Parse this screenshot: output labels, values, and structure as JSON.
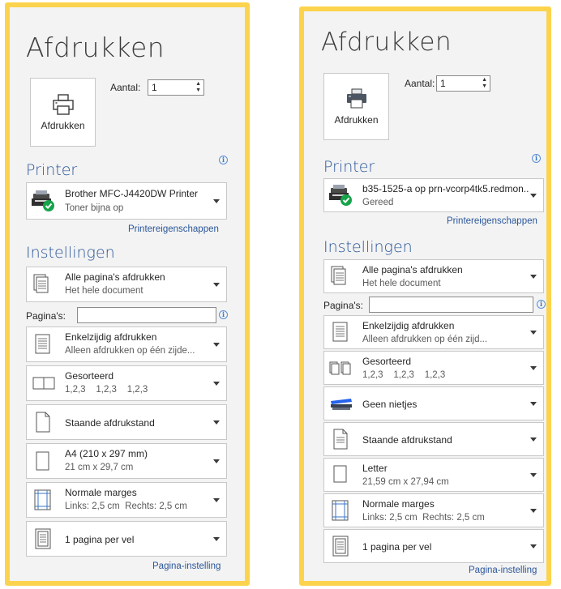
{
  "left": {
    "title": "Afdrukken",
    "print_button": "Afdrukken",
    "copies_label": "Aantal:",
    "copies_value": "1",
    "printer_heading": "Printer",
    "printer": {
      "name": "Brother MFC-J4420DW Printer",
      "status": "Toner bijna op"
    },
    "printer_properties_link": "Printereigenschappen",
    "settings_heading": "Instellingen",
    "pages_label": "Pagina's:",
    "pages_value": "",
    "settings": [
      {
        "icon": "all-pages-icon",
        "line1": "Alle pagina's afdrukken",
        "line2": "Het hele document"
      },
      {
        "icon": "one-sided-icon",
        "line1": "Enkelzijdig afdrukken",
        "line2": "Alleen afdrukken op één zijde..."
      },
      {
        "icon": "collated-icon",
        "line1": "Gesorteerd",
        "line2": "1,2,3    1,2,3    1,2,3"
      },
      {
        "icon": "portrait-icon",
        "line1": "Staande afdrukstand",
        "line2": ""
      },
      {
        "icon": "paper-size-icon",
        "line1": "A4 (210 x 297 mm)",
        "line2": "21 cm x 29,7 cm"
      },
      {
        "icon": "margins-icon",
        "line1": "Normale marges",
        "line2": "Links: 2,5 cm  Rechts: 2,5 cm"
      },
      {
        "icon": "pages-per-sheet-icon",
        "line1": "1 pagina per vel",
        "line2": ""
      }
    ],
    "page_setup_link": "Pagina-instelling"
  },
  "right": {
    "title": "Afdrukken",
    "print_button": "Afdrukken",
    "copies_label": "Aantal:",
    "copies_value": "1",
    "printer_heading": "Printer",
    "printer": {
      "name": "b35-1525-a op prn-vcorp4tk5.redmon...",
      "status": "Gereed"
    },
    "printer_properties_link": "Printereigenschappen",
    "settings_heading": "Instellingen",
    "pages_label": "Pagina's:",
    "pages_value": "",
    "settings": [
      {
        "icon": "all-pages-icon",
        "line1": "Alle pagina's afdrukken",
        "line2": "Het hele document"
      },
      {
        "icon": "one-sided-icon",
        "line1": "Enkelzijdig afdrukken",
        "line2": "Alleen afdrukken op één zijd..."
      },
      {
        "icon": "collated-icon",
        "line1": "Gesorteerd",
        "line2": "1,2,3    1,2,3    1,2,3"
      },
      {
        "icon": "staple-icon",
        "line1": "Geen nietjes",
        "line2": ""
      },
      {
        "icon": "portrait-icon",
        "line1": "Staande afdrukstand",
        "line2": ""
      },
      {
        "icon": "paper-size-icon",
        "line1": "Letter",
        "line2": "21,59 cm x 27,94 cm"
      },
      {
        "icon": "margins-icon",
        "line1": "Normale marges",
        "line2": "Links: 2,5 cm  Rechts: 2,5 cm"
      },
      {
        "icon": "pages-per-sheet-icon",
        "line1": "1 pagina per vel",
        "line2": ""
      }
    ],
    "page_setup_link": "Pagina-instelling"
  },
  "colors": {
    "frame": "#fcd34d",
    "panel_bg": "#f3f3f3",
    "accent_blue": "#2b579a",
    "ready_green": "#16a34a"
  }
}
